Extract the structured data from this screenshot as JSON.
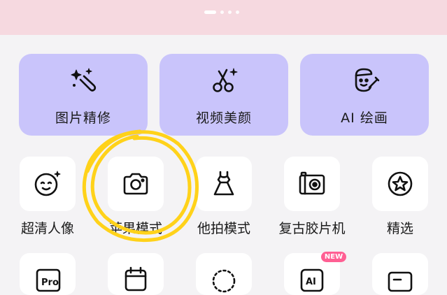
{
  "features": [
    {
      "label": "图片精修",
      "icon": "magic-wand-icon"
    },
    {
      "label": "视频美颜",
      "icon": "scissors-icon"
    },
    {
      "label": "AI 绘画",
      "icon": "painter-face-icon"
    }
  ],
  "modes": [
    {
      "label": "超清人像",
      "icon": "face-icon"
    },
    {
      "label": "苹果模式",
      "icon": "camera-icon"
    },
    {
      "label": "他拍模式",
      "icon": "dress-icon"
    },
    {
      "label": "复古胶片机",
      "icon": "retro-camera-icon"
    },
    {
      "label": "精选",
      "icon": "star-icon"
    }
  ],
  "row2": {
    "badge": "NEW",
    "tile1_text": "Pro",
    "tile4_text": "AI"
  },
  "colors": {
    "banner": "#f6d9e0",
    "card": "#c9c4fb",
    "highlight": "#ffd21a",
    "badge": "#ff5f93"
  }
}
